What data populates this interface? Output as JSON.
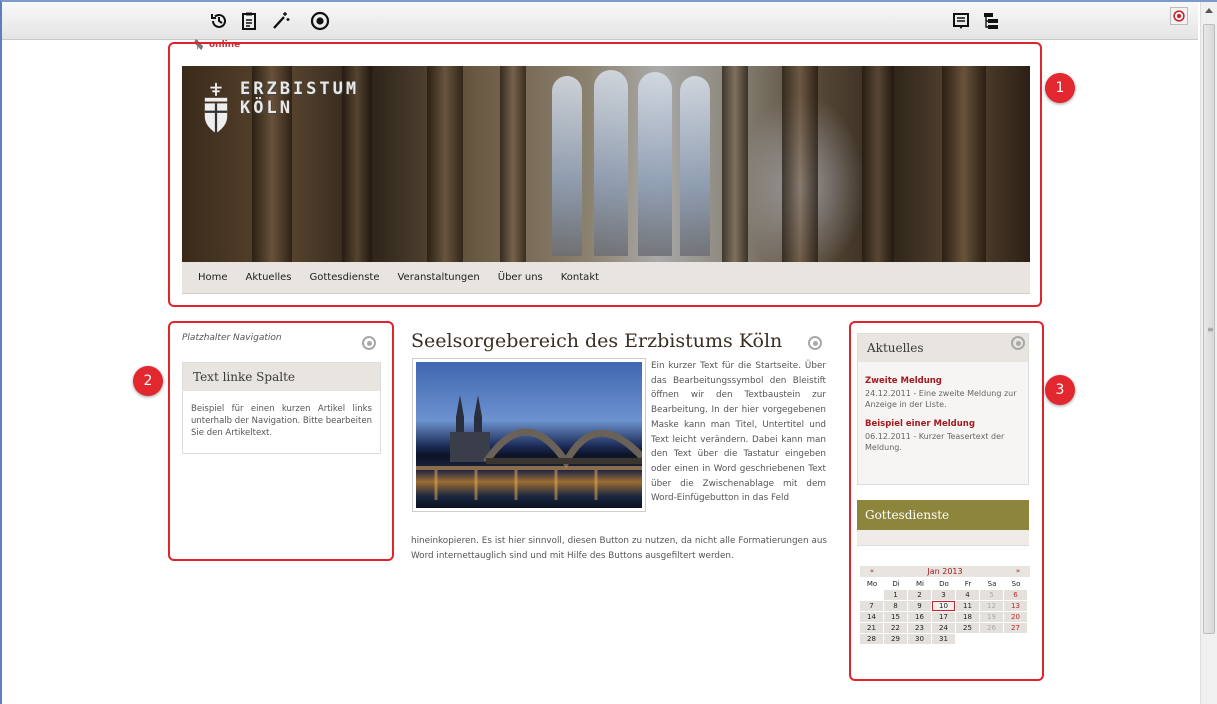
{
  "toolbar": {
    "left_icons": [
      "history-icon",
      "clipboard-icon",
      "magic-wand-icon",
      "target-icon"
    ],
    "right_icons": [
      "list-icon",
      "tree-icon",
      "target-icon"
    ]
  },
  "header": {
    "online_label": "online",
    "logo_line1": "ERZBISTUM",
    "logo_line2": "KÖLN",
    "nav": [
      "Home",
      "Aktuelles",
      "Gottesdienste",
      "Veranstaltungen",
      "Über uns",
      "Kontakt"
    ]
  },
  "annotations": [
    "1",
    "2",
    "3"
  ],
  "left": {
    "nav_placeholder": "Platzhalter Navigation",
    "box_title": "Text linke Spalte",
    "box_text": "Beispiel für einen kurzen Artikel links unterhalb der Navigation. Bitte bearbeiten Sie den Artikeltext."
  },
  "main": {
    "title": "Seelsorgebereich des Erzbistums Köln",
    "text_side": "Ein kurzer Text für die Startseite. Über das Bearbeitungssymbol den Bleistift öffnen wir den Textbaustein zur Bearbeitung. In der hier vorgegebenen Maske kann man Titel, Untertitel und Text leicht verändern. Dabei kann man den Text über die Tastatur eingeben oder einen in Word geschriebenen Text über die Zwischenablage mit dem Word-Einfügebutton in das Feld",
    "text_bottom": "hineinkopieren. Es ist hier sinnvoll, diesen Button zu nutzen, da nicht alle Formatierungen aus Word internettauglich sind und mit Hilfe des Buttons ausgefiltert werden."
  },
  "right": {
    "news_title": "Aktuelles",
    "news": [
      {
        "title": "Zweite Meldung",
        "text": "24.12.2011 - Eine zweite Meldung zur Anzeige in der Liste."
      },
      {
        "title": "Beispiel einer Meldung",
        "text": "06.12.2011 - Kurzer Teasertext der Meldung."
      }
    ],
    "services_title": "Gottesdienste",
    "calendar": {
      "prev": "«",
      "next": "»",
      "month": "Jan 2013",
      "weekdays": [
        "Mo",
        "Di",
        "Mi",
        "Do",
        "Fr",
        "Sa",
        "So"
      ],
      "weeks": [
        [
          "",
          "1",
          "2",
          "3",
          "4",
          "5",
          "6"
        ],
        [
          "7",
          "8",
          "9",
          "10",
          "11",
          "12",
          "13"
        ],
        [
          "14",
          "15",
          "16",
          "17",
          "18",
          "19",
          "20"
        ],
        [
          "21",
          "22",
          "23",
          "24",
          "25",
          "26",
          "27"
        ],
        [
          "28",
          "29",
          "30",
          "31",
          "",
          "",
          ""
        ]
      ],
      "today": "10"
    }
  },
  "colors": {
    "annotation": "#e0232d",
    "accent_red": "#a3191e",
    "olive": "#8d853b"
  }
}
